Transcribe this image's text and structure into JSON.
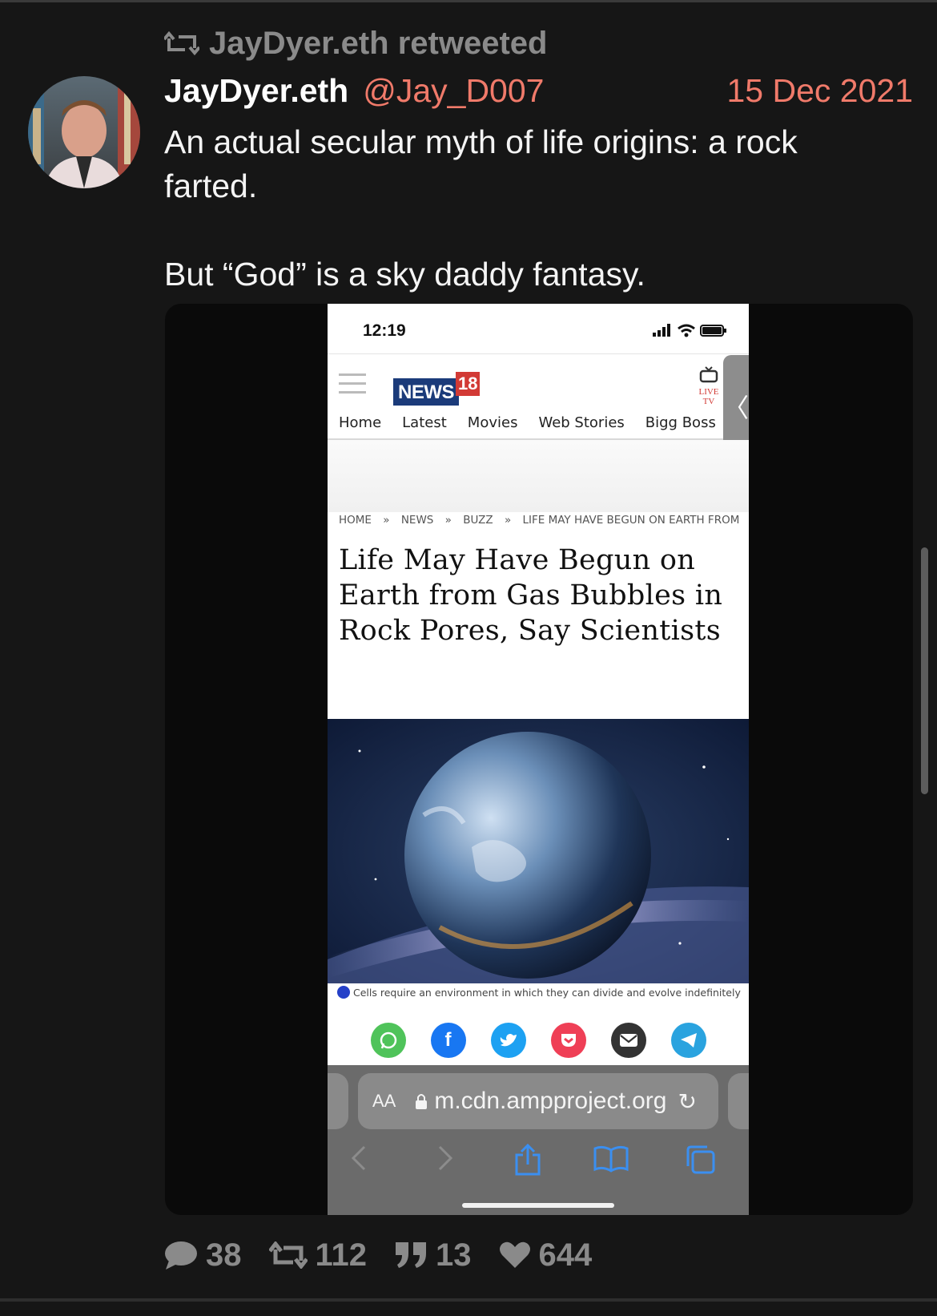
{
  "retweet_banner": {
    "text": "JayDyer.eth retweeted"
  },
  "tweet": {
    "author_name": "JayDyer.eth",
    "handle": "@Jay_D007",
    "date": "15 Dec 2021",
    "text_p1": "An actual secular myth of life origins: a rock farted.",
    "text_p2": "But “God” is a sky daddy fantasy."
  },
  "screenshot": {
    "status_time": "12:19",
    "logo_text": "NEWS",
    "logo_number": "18",
    "live_tv_label": "LIVE TV",
    "nav": [
      "Home",
      "Latest",
      "Movies",
      "Web Stories",
      "Bigg Boss"
    ],
    "breadcrumb": [
      "HOME",
      "»",
      "NEWS",
      "»",
      "BUZZ",
      "»",
      "LIFE MAY HAVE BEGUN ON EARTH FROM GAS"
    ],
    "headline": "Life May Have Begun on Earth from Gas Bubbles in Rock Pores, Say Scientists",
    "caption": "Cells require an environment in which they can divide and evolve indefinitely",
    "share_colors": {
      "whatsapp": "#4fc35a",
      "facebook": "#1877f2",
      "twitter": "#1da1f2",
      "pocket": "#ef3f56",
      "email": "#333333",
      "telegram": "#2aa3df"
    },
    "url_aa": "AA",
    "url": "m.cdn.ampproject.org"
  },
  "actions": {
    "replies": "38",
    "retweets": "112",
    "quotes": "13",
    "likes": "644"
  },
  "colors": {
    "background": "#161616",
    "accent": "#f07a6a",
    "muted": "#8a8a8a"
  }
}
